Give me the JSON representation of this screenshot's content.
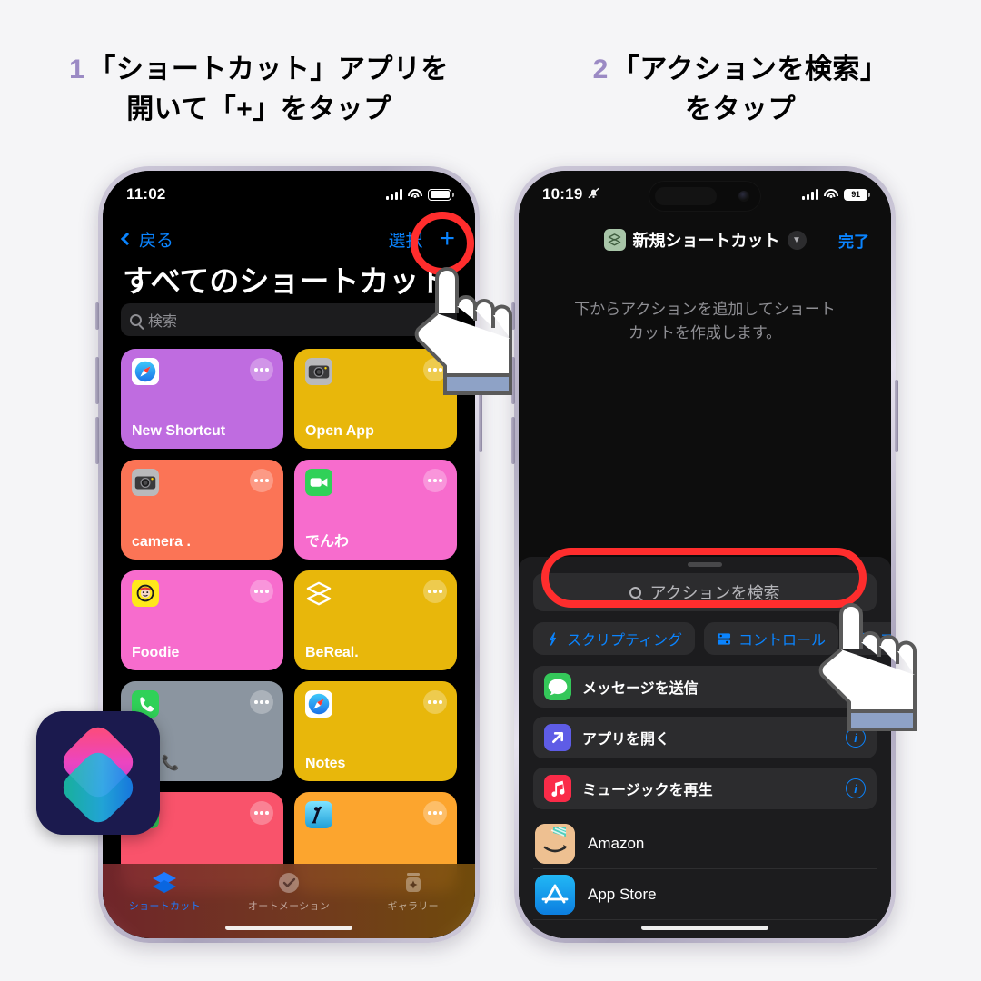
{
  "captions": {
    "step1": {
      "num": "1",
      "line1": "「ショートカット」アプリを",
      "line2": "開いて「+」をタップ"
    },
    "step2": {
      "num": "2",
      "line1": "「アクションを検索」",
      "line2": "をタップ"
    },
    "num_color": "#9b8ac4"
  },
  "left_phone": {
    "status": {
      "time": "11:02",
      "battery": "full",
      "signal": "4-bars",
      "wifi": "wifi-icon"
    },
    "nav": {
      "back_label": "戻る",
      "select_label": "選択",
      "add_label": "+"
    },
    "title": "すべてのショートカット",
    "search": {
      "placeholder": "検索",
      "icon": "search-icon"
    },
    "tiles": [
      {
        "name": "New Shortcut",
        "color": "#bf6ce0",
        "icon": "safari-icon"
      },
      {
        "name": "Open App",
        "color": "#e8b70b",
        "icon": "camera-icon"
      },
      {
        "name": "camera .",
        "color": "#fb7456",
        "icon": "camera-icon"
      },
      {
        "name": "でんわ",
        "color": "#f76ccd",
        "icon": "facetime-icon"
      },
      {
        "name": "Foodie",
        "color": "#f76ccd",
        "icon": "foodie-icon"
      },
      {
        "name": "BeReal.",
        "color": "#e8b70b",
        "icon": "shortcuts-glyph-icon"
      },
      {
        "name": "one 📞",
        "color": "#8b95a0",
        "icon": "phone-icon"
      },
      {
        "name": "Notes",
        "color": "#e8b70b",
        "icon": "safari-icon"
      },
      {
        "name": "",
        "color": "#f9536b",
        "icon": "messages-icon"
      },
      {
        "name": "",
        "color": "#fca52e",
        "icon": "kindle-icon"
      }
    ],
    "tabs": [
      {
        "label": "ショートカット",
        "icon": "layers-icon",
        "active": true
      },
      {
        "label": "オートメーション",
        "icon": "clock-check-icon",
        "active": false
      },
      {
        "label": "ギャラリー",
        "icon": "gallery-jar-icon",
        "active": false
      }
    ]
  },
  "right_phone": {
    "status": {
      "time": "10:19",
      "mute": "bell-slash-icon",
      "battery_pct": "91",
      "signal": "4-bars",
      "wifi": "wifi-icon"
    },
    "nav": {
      "title": "新規ショートカット",
      "icon": "shortcuts-glyph-icon",
      "caret": "chevron-down-icon",
      "done_label": "完了"
    },
    "hint_line1": "下からアクションを追加してショート",
    "hint_line2": "カットを作成します。",
    "search": {
      "placeholder": "アクションを検索",
      "icon": "search-icon"
    },
    "chips": [
      {
        "label": "スクリプティング",
        "icon": "script-icon"
      },
      {
        "label": "コントロール",
        "icon": "control-icon"
      },
      {
        "label": "ア",
        "icon": "app-icon"
      }
    ],
    "action_rows": [
      {
        "label": "メッセージを送信",
        "icon": "messages-icon",
        "color": "#34c759",
        "info": false
      },
      {
        "label": "アプリを開く",
        "icon": "open-app-icon",
        "color": "#5e5ce6",
        "info": true
      },
      {
        "label": "ミュージックを再生",
        "icon": "music-icon",
        "color": "#fa2b48",
        "info": true
      }
    ],
    "app_rows": [
      {
        "label": "Amazon",
        "icon": "amazon-icon",
        "color": "#eec091"
      },
      {
        "label": "App Store",
        "icon": "appstore-icon",
        "color": "#1c9ff0"
      }
    ]
  },
  "overlays": {
    "highlight_color": "#ff2d2d",
    "cursor": "pointing-hand-cursor",
    "app_icon": "shortcuts-app-icon"
  }
}
